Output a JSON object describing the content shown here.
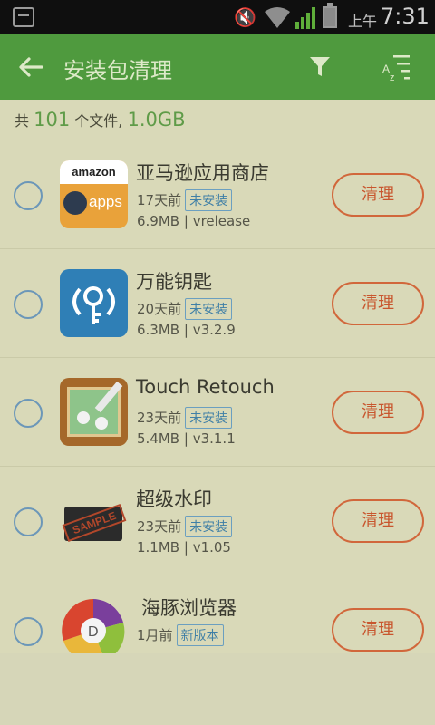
{
  "status_bar": {
    "ampm": "上午",
    "time": "7:31"
  },
  "header": {
    "title": "安装包清理"
  },
  "summary": {
    "prefix": "共",
    "file_count": "101",
    "files_label": "个文件,",
    "total_size": "1.0GB"
  },
  "items": [
    {
      "name": "亚马逊应用商店",
      "age": "17天前",
      "status": "未安装",
      "size": "6.9MB",
      "version": "vrelease",
      "action": "清理"
    },
    {
      "name": "万能钥匙",
      "age": "20天前",
      "status": "未安装",
      "size": "6.3MB",
      "version": "v3.2.9",
      "action": "清理"
    },
    {
      "name": "Touch Retouch",
      "age": "23天前",
      "status": "未安装",
      "size": "5.4MB",
      "version": "v3.1.1",
      "action": "清理"
    },
    {
      "name": "超级水印",
      "age": "23天前",
      "status": "未安装",
      "size": "1.1MB",
      "version": "v1.05",
      "action": "清理"
    },
    {
      "name": "海豚浏览器",
      "age": "1月前",
      "status": "新版本",
      "size": "",
      "version": "",
      "action": "清理"
    }
  ],
  "icons": {
    "amazon": {
      "top_text": "amazon",
      "bottom_text": "apps"
    },
    "watermark": {
      "stamp_text": "SAMPLE"
    },
    "dolphin": {
      "letter": "D"
    }
  },
  "colors": {
    "app_bar": "#4f9a3e",
    "accent_green": "#5f9b48",
    "button_orange": "#d1673b",
    "badge_blue": "#3f7fa6"
  }
}
